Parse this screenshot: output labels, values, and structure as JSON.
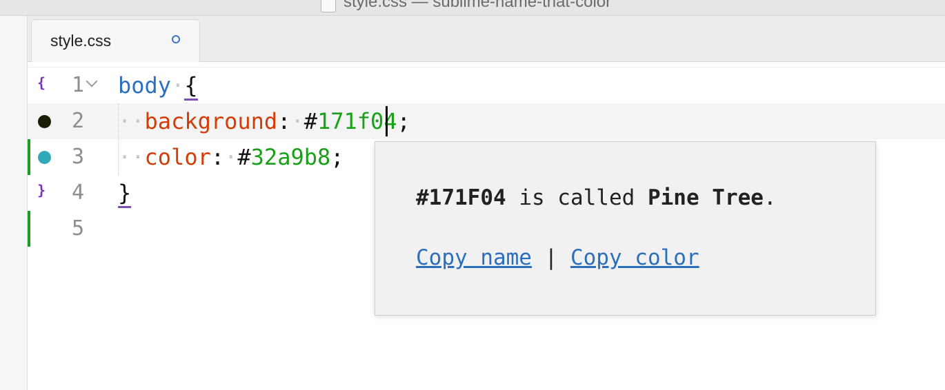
{
  "window": {
    "title": "style.css — sublime-name-that-color"
  },
  "tabs": [
    {
      "label": "style.css",
      "dirty": true
    }
  ],
  "editor": {
    "lines": [
      {
        "number": "1",
        "selector": "body",
        "brace": "{",
        "gutter": "{"
      },
      {
        "number": "2",
        "property": "background",
        "hex_prefix": "#",
        "hex_value": "171f04",
        "color_swatch": "#171f04"
      },
      {
        "number": "3",
        "property": "color",
        "hex_prefix": "#",
        "hex_value": "32a9b8",
        "color_swatch": "#32a9b8"
      },
      {
        "number": "4",
        "brace": "}",
        "gutter": "}"
      },
      {
        "number": "5"
      }
    ]
  },
  "popup": {
    "color_code": "#171F04",
    "middle_text": " is called ",
    "color_name": "Pine Tree",
    "end_text": ".",
    "copy_name_label": "Copy name",
    "separator": " | ",
    "copy_color_label": "Copy color"
  },
  "colors": {
    "selector": "#2b6fc0",
    "property": "#d23d08",
    "hex": "#19a019",
    "link": "#2a6ebd",
    "gutter_modified": "#1a9f1a"
  }
}
